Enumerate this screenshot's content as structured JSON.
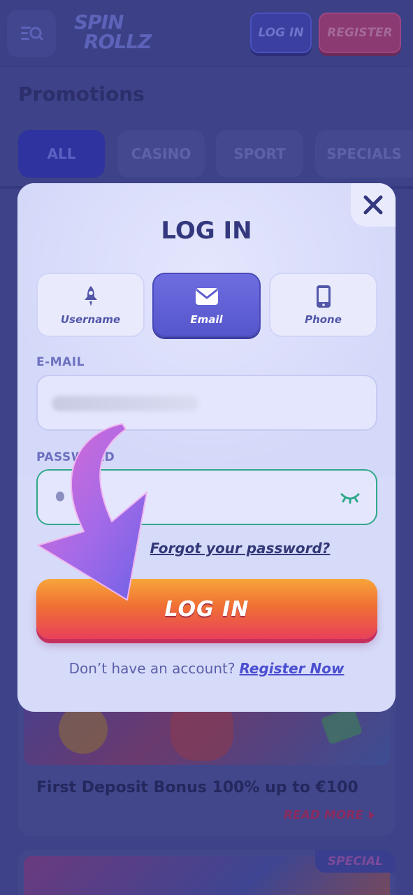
{
  "header": {
    "logo_line1": "SPIN",
    "logo_line2": "ROLLZ",
    "login_label": "LOG IN",
    "register_label": "REGISTER"
  },
  "page": {
    "title": "Promotions",
    "tabs": [
      {
        "label": "ALL",
        "active": true
      },
      {
        "label": "CASINO",
        "active": false
      },
      {
        "label": "SPORT",
        "active": false
      },
      {
        "label": "SPECIALS",
        "active": false
      }
    ]
  },
  "promotions": [
    {
      "title": "First Deposit Bonus 100% up to €100",
      "read_more": "READ MORE"
    },
    {
      "badge": "SPECIAL"
    }
  ],
  "modal": {
    "title": "LOG IN",
    "methods": [
      {
        "label": "Username",
        "icon": "rocket-icon",
        "active": false
      },
      {
        "label": "Email",
        "icon": "envelope-icon",
        "active": true
      },
      {
        "label": "Phone",
        "icon": "phone-icon",
        "active": false
      }
    ],
    "email_label": "E-MAIL",
    "password_label": "PASSWORD",
    "forgot_label": "Forgot your password?",
    "submit_label": "LOG IN",
    "no_account_text": "Don’t have an account?",
    "register_link": "Register Now"
  },
  "colors": {
    "accent": "#5656cc",
    "button_orange": "#f07034",
    "button_pink": "#e8405a",
    "focus_green": "#2fa88a",
    "modal_bg": "#d7dbfa"
  }
}
